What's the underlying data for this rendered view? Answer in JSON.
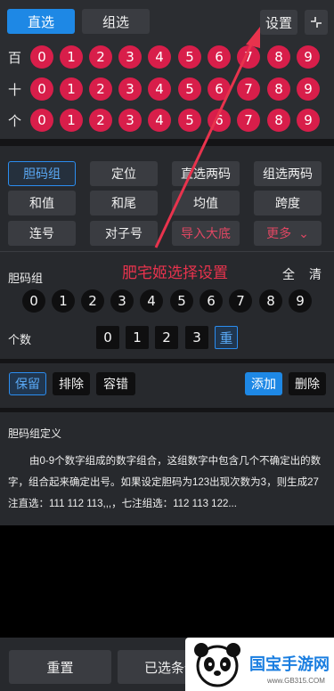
{
  "header": {
    "tabs": [
      {
        "label": "直选",
        "active": true
      },
      {
        "label": "组选",
        "active": false
      }
    ],
    "settings_label": "设置",
    "collapse_icon": "collapse-icon"
  },
  "digit_rows": [
    {
      "label": "百",
      "digits": [
        "0",
        "1",
        "2",
        "3",
        "4",
        "5",
        "6",
        "7",
        "8",
        "9"
      ]
    },
    {
      "label": "十",
      "digits": [
        "0",
        "1",
        "2",
        "3",
        "4",
        "5",
        "6",
        "7",
        "8",
        "9"
      ]
    },
    {
      "label": "个",
      "digits": [
        "0",
        "1",
        "2",
        "3",
        "4",
        "5",
        "6",
        "7",
        "8",
        "9"
      ]
    }
  ],
  "play_types": [
    {
      "label": "胆码组",
      "selected": true
    },
    {
      "label": "定位",
      "selected": false
    },
    {
      "label": "直选两码",
      "selected": false
    },
    {
      "label": "组选两码",
      "selected": false
    },
    {
      "label": "和值",
      "selected": false
    },
    {
      "label": "和尾",
      "selected": false
    },
    {
      "label": "均值",
      "selected": false
    },
    {
      "label": "跨度",
      "selected": false
    },
    {
      "label": "连号",
      "selected": false
    },
    {
      "label": "对子号",
      "selected": false
    },
    {
      "label": "导入大底",
      "selected": false
    },
    {
      "label": "更多",
      "selected": false
    }
  ],
  "dan_ma": {
    "label": "胆码组",
    "all_label": "全",
    "clear_label": "清",
    "digits": [
      "0",
      "1",
      "2",
      "3",
      "4",
      "5",
      "6",
      "7",
      "8",
      "9"
    ],
    "count_label": "个数",
    "counts": [
      "0",
      "1",
      "2",
      "3",
      "重"
    ],
    "selected_count": "重"
  },
  "actions": {
    "keep": "保留",
    "exclude": "排除",
    "tolerance": "容错",
    "add": "添加",
    "delete": "删除"
  },
  "definition": {
    "title": "胆码组定义",
    "body": "由0-9个数字组成的数字组合，这组数字中包含几个不确定出的数字，组合起来确定出号。如果设定胆码为123出现次数为3，则生成27注直选：111 112 113,,,，七注组选：112 113 122..."
  },
  "bottom": {
    "reset": "重置",
    "selected": "已选条件"
  },
  "annotation": {
    "text": "肥宅姬选择设置",
    "color": "#e8334d"
  },
  "watermark": {
    "name": "国宝手游网",
    "url": "www.GB315.COM"
  },
  "colors": {
    "accent": "#1e88e5",
    "ball_red": "#d81e4a",
    "danger_text": "#e04763"
  }
}
